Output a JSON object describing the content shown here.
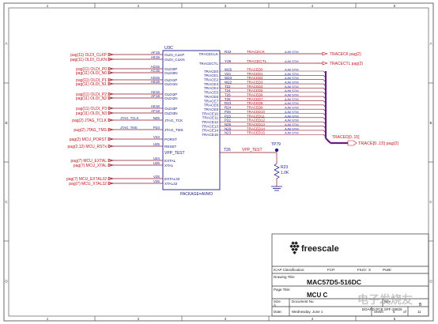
{
  "border": {
    "columns": [
      "1",
      "2",
      "3",
      "4",
      "5"
    ],
    "rows": [
      "A",
      "B",
      "C",
      "D"
    ]
  },
  "part": {
    "ref": "U3C",
    "footprint": "PACKAGE=AVMO"
  },
  "left_signals": [
    {
      "net": "pag(11) OLDI_CLKP",
      "pin": "AF15",
      "pin_name": "OLDI_CLKP"
    },
    {
      "net": "pag(11) OLDI_CLKN",
      "pin": "AE15",
      "pin_name": "OLDI_CLKN"
    },
    {
      "net": "pag(11) OLDI_P0",
      "pin": "AD15",
      "pin_name": "OLDI0P"
    },
    {
      "net": "pag(11) OLDI_N0",
      "pin": "AC15",
      "pin_name": "OLDI0N"
    },
    {
      "net": "pag(11) OLDI_P1",
      "pin": "AD15",
      "pin_name": "OLDI1P"
    },
    {
      "net": "pag(11) OLDI_N1",
      "pin": "AE15",
      "pin_name": "OLDI1N"
    },
    {
      "net": "pag(11) OLDI_P2",
      "pin": "AE16",
      "pin_name": "OLDI2P"
    },
    {
      "net": "pag(11) OLDI_N2",
      "pin": "AF16",
      "pin_name": "OLDI2N"
    },
    {
      "net": "pag(11) OLDI_P3",
      "pin": "AE16",
      "pin_name": "OLDI3P"
    },
    {
      "net": "pag(11) OLDI_N3",
      "pin": "AF16",
      "pin_name": "OLDI3N"
    },
    {
      "net": "pag(2) JTAG_TCLK",
      "pin": "N25",
      "pin_name": "JTAG_TCK",
      "wire_label": "JTAG_TCLK"
    },
    {
      "net": "pag(2) JTAG_TMS",
      "pin": "P24",
      "pin_name": "JTAG_TMS",
      "wire_label": "JTAG_TMS"
    },
    {
      "net": "pag(2) MCU_PORST",
      "pin": "V24",
      "pin_name": "PORST"
    },
    {
      "net": "pag(2,12) MCU_RSTx",
      "pin": "U25",
      "pin_name": "RESET"
    },
    {
      "net": "pag(7) MCU_EXTAL",
      "pin": "U24",
      "pin_name": "EXTAL"
    },
    {
      "net": "pag(7) MCU_XTAL",
      "pin": "U26",
      "pin_name": "XTAL"
    },
    {
      "net": "pag(7) MCU_EXTAL32",
      "pin": "V25",
      "pin_name": "EXTAL32"
    },
    {
      "net": "pag(7) MCU_XTAL32",
      "pin": "V26",
      "pin_name": "XTAL32"
    }
  ],
  "right_clock_signals": [
    {
      "pin_name": "TRACECLK",
      "pin": "R22",
      "wire_label": "TRACECK",
      "marker": "AJM STM",
      "net": "TRACECK pag(2)"
    },
    {
      "pin_name": "TRACECTL",
      "pin": "Y26",
      "wire_label": "TRACECTL",
      "marker": "AJM STM",
      "net": "TRACECTL pag(2)"
    }
  ],
  "trace_bus": {
    "net": "TRACE[0..15] pag(2)",
    "bus_label": "TRACED[0..15]",
    "marker": "AJM STM",
    "pins": [
      {
        "pin_name": "TRACE0",
        "pin": "W26",
        "wire_label": "TRACED0"
      },
      {
        "pin_name": "TRACE1",
        "pin": "V24",
        "wire_label": "TRACED1"
      },
      {
        "pin_name": "TRACE2",
        "pin": "W23",
        "wire_label": "TRACED2"
      },
      {
        "pin_name": "TRACE3",
        "pin": "W22",
        "wire_label": "TRACED3"
      },
      {
        "pin_name": "TRACE4",
        "pin": "T22",
        "wire_label": "TRACED4"
      },
      {
        "pin_name": "TRACE5",
        "pin": "T24",
        "wire_label": "TRACED5"
      },
      {
        "pin_name": "TRACE6",
        "pin": "T25",
        "wire_label": "TRACED6"
      },
      {
        "pin_name": "TRACE7",
        "pin": "T26",
        "wire_label": "TRACED7"
      },
      {
        "pin_name": "TRACE8",
        "pin": "R23",
        "wire_label": "TRACED8"
      },
      {
        "pin_name": "TRACE9",
        "pin": "R24",
        "wire_label": "TRACED9"
      },
      {
        "pin_name": "TRACE10",
        "pin": "P26",
        "wire_label": "TRACED10"
      },
      {
        "pin_name": "TRACE11",
        "pin": "P23",
        "wire_label": "TRACED11"
      },
      {
        "pin_name": "TRACE12",
        "pin": "P22",
        "wire_label": "TRACED12"
      },
      {
        "pin_name": "TRACE13",
        "pin": "N25",
        "wire_label": "TRACED13"
      },
      {
        "pin_name": "TRACE14",
        "pin": "N26",
        "wire_label": "TRACED14"
      },
      {
        "pin_name": "TRACE15",
        "pin": "N23",
        "wire_label": "TRACED15"
      }
    ]
  },
  "vpp": {
    "pin_name": "VPP_TEST",
    "pin": "T26",
    "wire_label": "VPP_TEST",
    "test_point": "TP79",
    "resistor_ref": "R23",
    "resistor_value": "1.0K"
  },
  "title_block": {
    "logo": "freescale",
    "classification_label": "ICAP Classification:",
    "fcp_label": "FCP:",
    "fiuo_label": "FIUO:",
    "fiuo_value": "X",
    "pubi_label": "PUBI:",
    "drawing_title_label": "Drawing Title:",
    "drawing_title": "MAC57D5-516DC",
    "page_title_label": "Page Title:",
    "page_title": "MCU C",
    "size_label": "Size",
    "size_value": "A",
    "document_number_label": "Document Nu",
    "rev_label": "Rev",
    "rev_value": "B",
    "board_label": "BOARD PCB SPF-28925",
    "date_label": "Date:",
    "date_value": "Wednesday, June 1",
    "sheet_label": "Sheet",
    "sheet_value": "6",
    "of_label": "of",
    "of_value": "11"
  },
  "watermark": "电子发烧友",
  "colors": {
    "net_label": "#c0161b",
    "wire": "#8b1528",
    "bus": "#6b1a86",
    "component": "#1a1a8c",
    "marker": "#2233aa",
    "frame": "#333333"
  }
}
